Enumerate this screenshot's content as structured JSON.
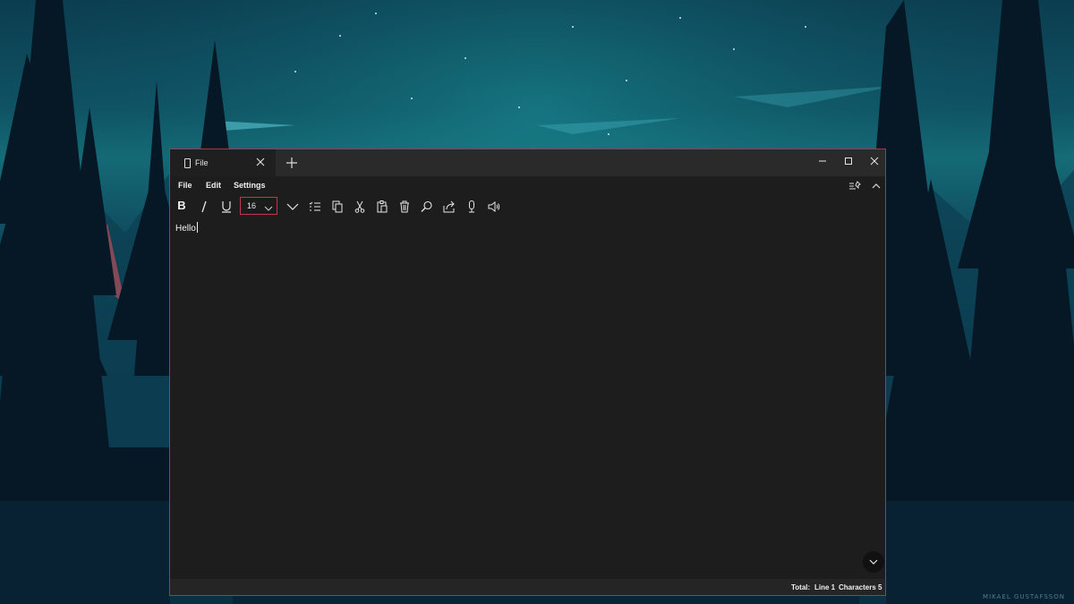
{
  "wallpaper": {
    "credit": "MIKAEL GUSTAFSSON"
  },
  "window": {
    "tab": {
      "title": "File",
      "icon": "document-icon"
    },
    "controls": [
      "minimize-icon",
      "maximize-icon",
      "close-icon"
    ],
    "accent": "#b0314a"
  },
  "menu": {
    "file": "File",
    "edit": "Edit",
    "settings": "Settings"
  },
  "toolbar": {
    "bold_label": "B",
    "font_size": "16",
    "icons": [
      "italic-icon",
      "underline-icon",
      "expand-icon",
      "list-icon",
      "copy-icon",
      "cut-icon",
      "paste-icon",
      "delete-icon",
      "search-icon",
      "share-icon",
      "microphone-icon",
      "speaker-icon"
    ]
  },
  "editor": {
    "content": "Hello"
  },
  "status": {
    "total": "Total:",
    "line": "Line 1",
    "characters": "Characters  5"
  }
}
